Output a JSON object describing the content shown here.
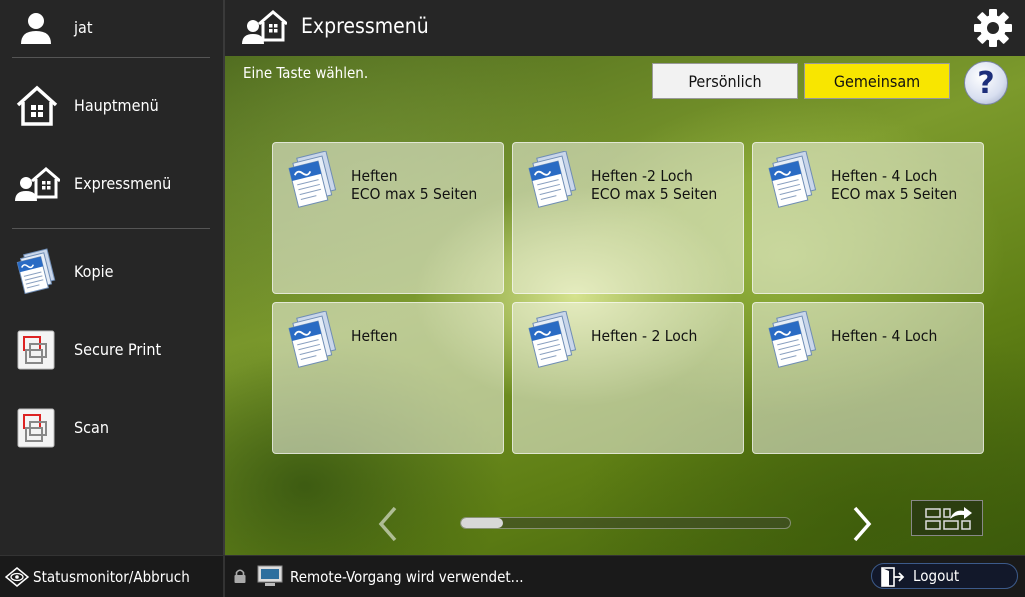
{
  "sidebar": {
    "user": {
      "name": "jat",
      "icon": "user-icon"
    },
    "items": [
      {
        "label": "Hauptmenü",
        "icon": "home-icon"
      },
      {
        "label": "Expressmenü",
        "icon": "express-menu-icon"
      },
      {
        "label": "Kopie",
        "icon": "copy-icon"
      },
      {
        "label": "Secure Print",
        "icon": "secure-print-icon"
      },
      {
        "label": "Scan",
        "icon": "scan-icon"
      }
    ]
  },
  "header": {
    "title": "Expressmenü",
    "icon": "express-menu-icon",
    "settings_icon": "gear-icon"
  },
  "main": {
    "prompt": "Eine Taste wählen.",
    "tabs": [
      {
        "label": "Persönlich",
        "active": false
      },
      {
        "label": "Gemeinsam",
        "active": true,
        "color": "#f8e600"
      }
    ],
    "help_label": "?",
    "tiles": [
      {
        "line1": "Heften",
        "line2": "ECO max 5 Seiten",
        "icon": "copy-icon"
      },
      {
        "line1": "Heften -2 Loch",
        "line2": "ECO max 5 Seiten",
        "icon": "copy-icon"
      },
      {
        "line1": "Heften - 4 Loch",
        "line2": "ECO max 5 Seiten",
        "icon": "copy-icon"
      },
      {
        "line1": "Heften",
        "line2": "",
        "icon": "copy-icon"
      },
      {
        "line1": "Heften - 2 Loch",
        "line2": "",
        "icon": "copy-icon"
      },
      {
        "line1": "Heften - 4 Loch",
        "line2": "",
        "icon": "copy-icon"
      }
    ],
    "scroll_position": 0.0
  },
  "statusbar": {
    "status_monitor_label": "Statusmonitor/Abbruch",
    "remote_text": "Remote-Vorgang wird verwendet...",
    "logout_label": "Logout"
  }
}
